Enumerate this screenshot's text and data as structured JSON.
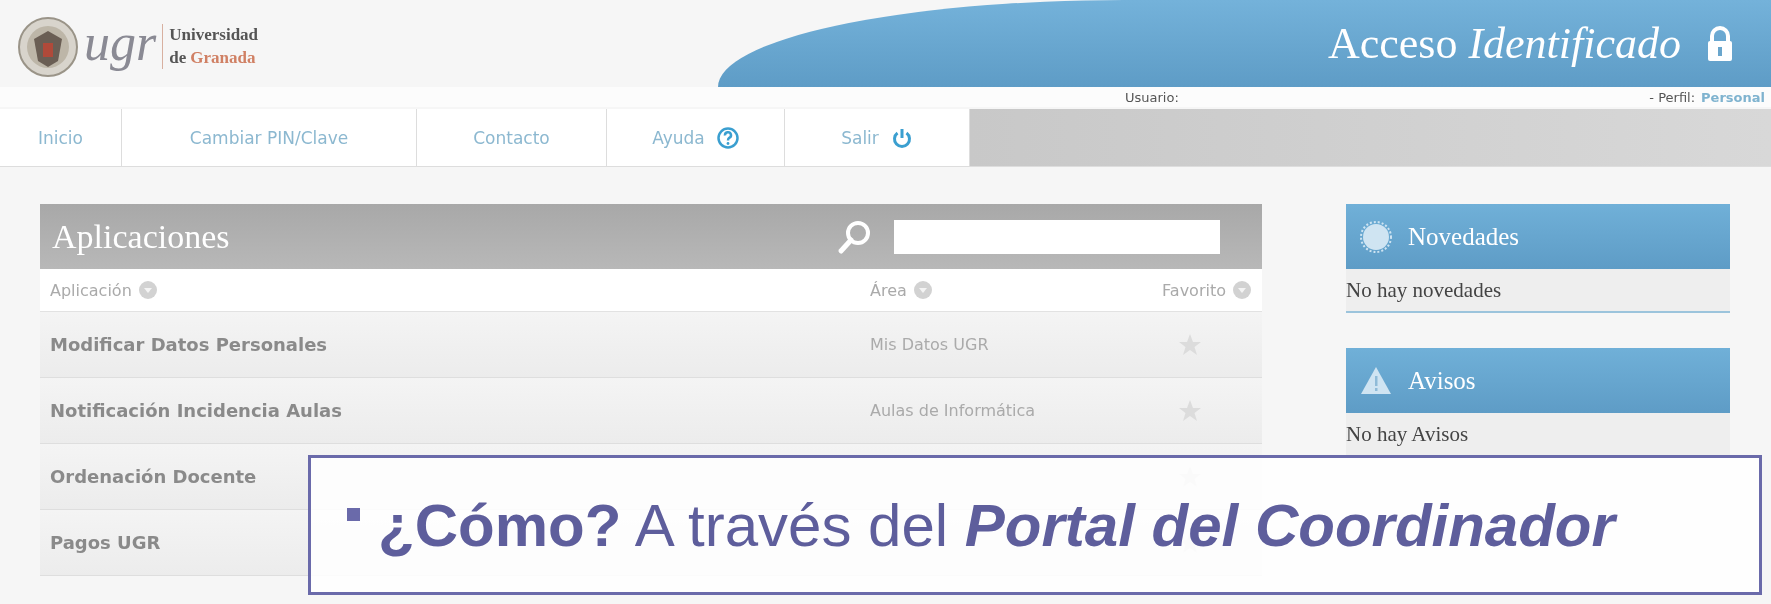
{
  "logo": {
    "wordmark": "ugr",
    "line1": "Universidad",
    "line2_prefix": "de",
    "line2_accent": "Granada"
  },
  "banner": {
    "title_plain": "Acceso",
    "title_italic": "Identificado"
  },
  "user_bar": {
    "user_label": "Usuario:",
    "profile_label": "- Perfil:",
    "profile_value": "Personal"
  },
  "nav": [
    {
      "label": "Inicio",
      "kind": "plain"
    },
    {
      "label": "Cambiar PIN/Clave",
      "kind": "plain"
    },
    {
      "label": "Contacto",
      "kind": "plain"
    },
    {
      "label": "Ayuda",
      "kind": "help"
    },
    {
      "label": "Salir",
      "kind": "power"
    }
  ],
  "applications": {
    "title": "Aplicaciones",
    "columns": [
      "Aplicación",
      "Área",
      "Favorito"
    ],
    "rows": [
      {
        "name": "Modificar Datos Personales",
        "area": "Mis Datos UGR",
        "favorite": false
      },
      {
        "name": "Notificación Incidencia Aulas",
        "area": "Aulas de Informática",
        "favorite": false
      },
      {
        "name": "Ordenación Docente",
        "favorite": false
      },
      {
        "name": "Pagos UGR",
        "favorite": false
      }
    ]
  },
  "side_panels": [
    {
      "kind": "news",
      "title": "Novedades",
      "body": "No hay novedades"
    },
    {
      "kind": "warning",
      "title": "Avisos",
      "body": "No hay Avisos"
    }
  ],
  "callout": {
    "text": "**¿Cómo?** A través del *Portal del Coordinador*"
  }
}
